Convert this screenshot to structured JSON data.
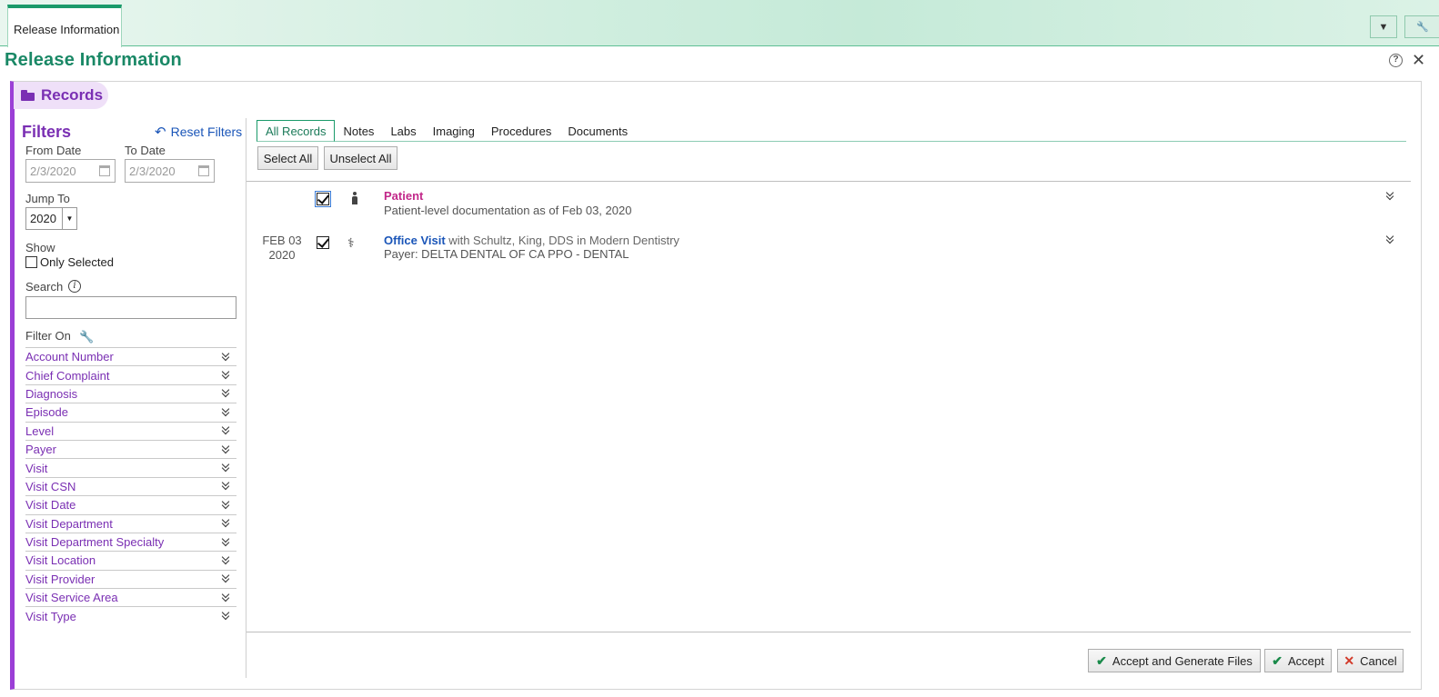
{
  "window": {
    "tab_label": "Release Information",
    "page_title": "Release Information"
  },
  "section": {
    "title": "Records"
  },
  "filters": {
    "title": "Filters",
    "reset_label": "Reset Filters",
    "from_date_label": "From Date",
    "from_date_value": "2/3/2020",
    "to_date_label": "To Date",
    "to_date_value": "2/3/2020",
    "jump_to_label": "Jump To",
    "jump_to_value": "2020",
    "show_label": "Show",
    "only_selected_label": "Only Selected",
    "search_label": "Search",
    "filter_on_label": "Filter On",
    "items": [
      "Account Number",
      "Chief Complaint",
      "Diagnosis",
      "Episode",
      "Level",
      "Payer",
      "Visit",
      "Visit CSN",
      "Visit Date",
      "Visit Department",
      "Visit Department Specialty",
      "Visit Location",
      "Visit Provider",
      "Visit Service Area",
      "Visit Type"
    ]
  },
  "record_tabs": [
    "All Records",
    "Notes",
    "Labs",
    "Imaging",
    "Procedures",
    "Documents"
  ],
  "toolbar": {
    "select_all": "Select All",
    "unselect_all": "Unselect All"
  },
  "records": [
    {
      "date_line1": "",
      "date_line2": "",
      "title": "Patient",
      "title_suffix": "",
      "subtitle": "Patient-level documentation as of Feb 03, 2020",
      "icon": "person-icon",
      "checked": true
    },
    {
      "date_line1": "FEB 03",
      "date_line2": "2020",
      "title": "Office Visit",
      "title_suffix": " with Schultz, King, DDS in Modern Dentistry",
      "subtitle": "Payer: DELTA DENTAL OF CA PPO - DENTAL",
      "icon": "stethoscope-icon",
      "checked": true
    }
  ],
  "actions": {
    "accept_generate": "Accept and Generate Files",
    "accept": "Accept",
    "cancel": "Cancel"
  },
  "colors": {
    "accent_green": "#1a8866",
    "accent_purple": "#7a2fb3",
    "patient_title": "#c2288a",
    "visit_title": "#1a55b8"
  }
}
